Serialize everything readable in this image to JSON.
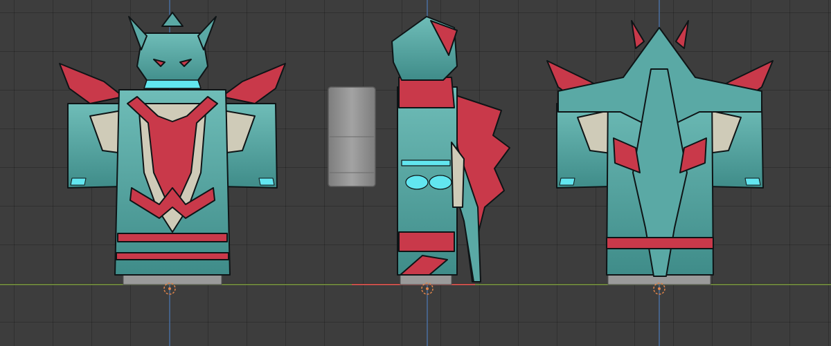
{
  "scene": {
    "background_color": "#3d3d3d",
    "grid_color": "#2f2f2f",
    "x_axis_color": "#7a9a3c",
    "x_axis_highlight_color": "#c8504a",
    "z_axis_color": "#4a6fa0",
    "origin_marker_color": "#e0844a"
  },
  "models": [
    {
      "view": "front",
      "icon": "armor-front-icon"
    },
    {
      "view": "side",
      "icon": "armor-side-icon"
    },
    {
      "view": "back",
      "icon": "armor-back-icon"
    }
  ],
  "palette": {
    "teal": "#5aa9a5",
    "teal_dark": "#2f6f6e",
    "crimson": "#c9394a",
    "bone": "#cfcbb8",
    "glow": "#62e6f0",
    "outline": "#0e1416",
    "block": "#8e8e8e"
  }
}
